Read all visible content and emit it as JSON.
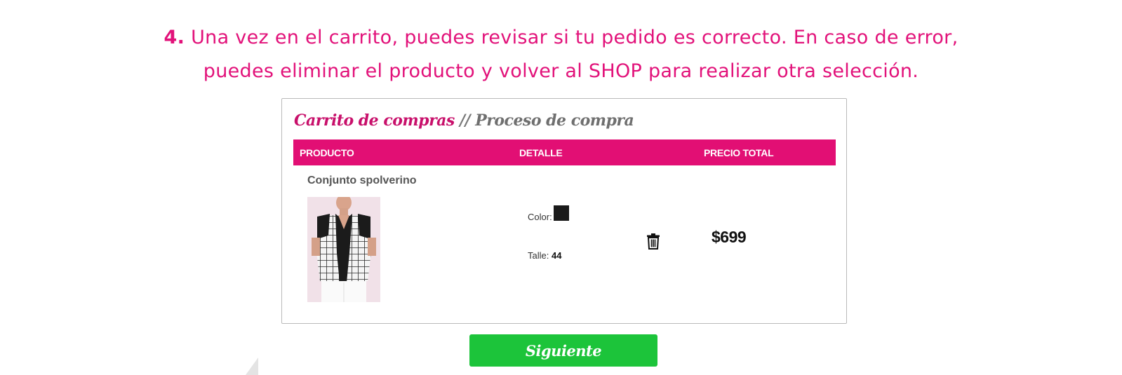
{
  "instruction": {
    "step_number": "4.",
    "line1": "Una vez en el carrito, puedes revisar si tu pedido es correcto. En caso de error,",
    "line2": "puedes eliminar el producto y volver al SHOP para realizar otra selección."
  },
  "cart": {
    "title_main": "Carrito de compras",
    "title_separator": "//",
    "title_secondary": "Proceso de compra",
    "columns": {
      "product": "PRODUCTO",
      "detail": "DETALLE",
      "total_price": "PRECIO TOTAL"
    },
    "item": {
      "name": "Conjunto spolverino",
      "color_label": "Color:",
      "color_value": "#1a1a1a",
      "size_label": "Talle:",
      "size_value": "44",
      "price": "$699",
      "delete_icon": "trash-icon"
    }
  },
  "next_button": {
    "label": "Siguiente"
  },
  "colors": {
    "brand_pink": "#e2127a",
    "header_pink": "#e20f74",
    "button_green": "#1cc43a"
  }
}
